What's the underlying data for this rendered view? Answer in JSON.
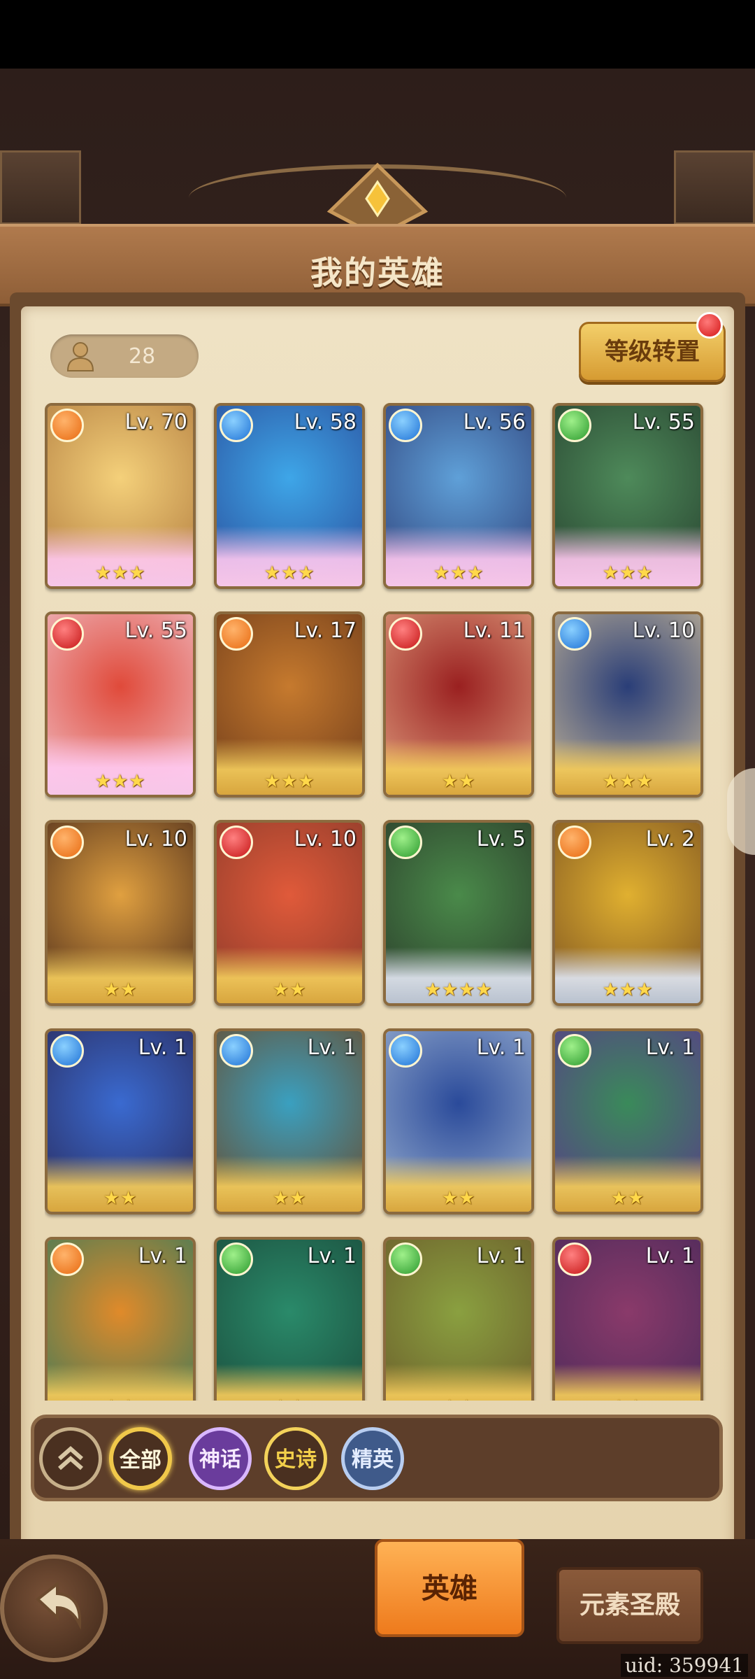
{
  "header": {
    "title": "我的英雄"
  },
  "hero_count": "28",
  "level_transfer_button": "等级转置",
  "heroes": [
    {
      "level": "Lv. 70",
      "element": "fire",
      "stars": "★★★",
      "frame": "legend",
      "palette": [
        "#f4d07a",
        "#b07a3e"
      ]
    },
    {
      "level": "Lv. 58",
      "element": "water",
      "stars": "★★★",
      "frame": "legend",
      "palette": [
        "#3ea6e8",
        "#2a4c9a"
      ]
    },
    {
      "level": "Lv. 56",
      "element": "water",
      "stars": "★★★",
      "frame": "legend",
      "palette": [
        "#5fa0d8",
        "#2e3f78"
      ]
    },
    {
      "level": "Lv. 55",
      "element": "nature",
      "stars": "★★★",
      "frame": "legend",
      "palette": [
        "#4e8a5a",
        "#26402e"
      ]
    },
    {
      "level": "Lv. 55",
      "element": "blood",
      "stars": "★★★",
      "frame": "legend",
      "palette": [
        "#e04a3a",
        "#f0c0c8"
      ]
    },
    {
      "level": "Lv. 17",
      "element": "fire",
      "stars": "★★★",
      "frame": "gold",
      "palette": [
        "#c67a2e",
        "#6e3b1a"
      ]
    },
    {
      "level": "Lv. 11",
      "element": "blood",
      "stars": "★★",
      "frame": "gold",
      "palette": [
        "#9a2020",
        "#e0a080"
      ]
    },
    {
      "level": "Lv. 10",
      "element": "water",
      "stars": "★★★",
      "frame": "gold",
      "palette": [
        "#2a3e78",
        "#c8b898"
      ]
    },
    {
      "level": "Lv. 10",
      "element": "fire",
      "stars": "★★",
      "frame": "gold",
      "palette": [
        "#e0a040",
        "#4a2a1a"
      ]
    },
    {
      "level": "Lv. 10",
      "element": "blood",
      "stars": "★★",
      "frame": "gold",
      "palette": [
        "#e05a3a",
        "#8a3a2a"
      ]
    },
    {
      "level": "Lv. 5",
      "element": "nature",
      "stars": "★★★★",
      "frame": "silver",
      "palette": [
        "#4a8a4a",
        "#2a3a2a"
      ]
    },
    {
      "level": "Lv. 2",
      "element": "fire",
      "stars": "★★★",
      "frame": "silver",
      "palette": [
        "#e0b030",
        "#7a5020"
      ]
    },
    {
      "level": "Lv. 1",
      "element": "water",
      "stars": "★★",
      "frame": "gold",
      "palette": [
        "#3a6ad0",
        "#2a2a5a"
      ]
    },
    {
      "level": "Lv. 1",
      "element": "water",
      "stars": "★★",
      "frame": "gold",
      "palette": [
        "#3aa0c0",
        "#6a4a2a"
      ]
    },
    {
      "level": "Lv. 1",
      "element": "water",
      "stars": "★★",
      "frame": "gold",
      "palette": [
        "#2a4a9a",
        "#9ab0d0"
      ]
    },
    {
      "level": "Lv. 1",
      "element": "nature",
      "stars": "★★",
      "frame": "gold",
      "palette": [
        "#3a8a5a",
        "#5a3a8a"
      ]
    },
    {
      "level": "Lv. 1",
      "element": "fire",
      "stars": "★★",
      "frame": "gold",
      "palette": [
        "#e08a2a",
        "#3a7a5a"
      ]
    },
    {
      "level": "Lv. 1",
      "element": "nature",
      "stars": "★★",
      "frame": "gold",
      "palette": [
        "#2a8a6a",
        "#1a4a3a"
      ]
    },
    {
      "level": "Lv. 1",
      "element": "nature",
      "stars": "★★",
      "frame": "gold",
      "palette": [
        "#8aa040",
        "#6a5a2a"
      ]
    },
    {
      "level": "Lv. 1",
      "element": "blood",
      "stars": "★★",
      "frame": "gold",
      "palette": [
        "#8a3a6a",
        "#4a2a5a"
      ]
    }
  ],
  "filters": {
    "all": "全部",
    "myth": "神话",
    "epic": "史诗",
    "elite": "精英"
  },
  "tabs": {
    "hero": "英雄",
    "temple": "元素圣殿"
  },
  "uid": "uid: 359941"
}
